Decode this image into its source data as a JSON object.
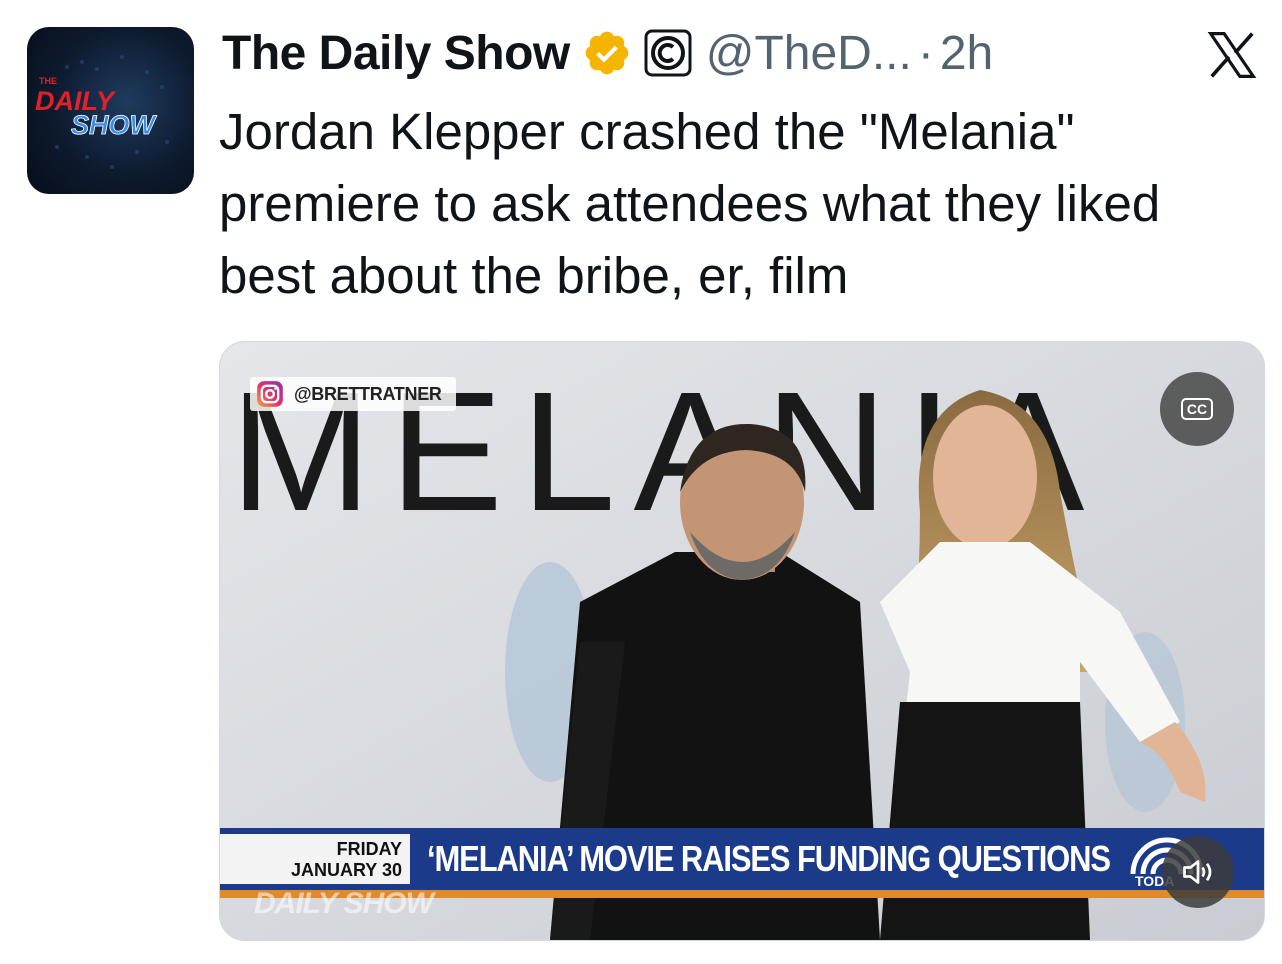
{
  "tweet": {
    "display_name": "The Daily Show",
    "handle": "@TheD...",
    "separator": "·",
    "time": "2h",
    "text": "Jordan Klepper crashed the \"Melania\" premiere to ask attendees what they liked best about the bribe, er, film",
    "verified_icon": "verified-badge-icon",
    "affiliation_icon": "comedy-central-icon"
  },
  "avatar": {
    "line1": "THE",
    "line2": "DAILY",
    "line3": "SHOW"
  },
  "media": {
    "backdrop_text": "MELANIA",
    "instagram_handle": "@BRETTRATNER",
    "caption_day": "FRIDAY",
    "caption_date": "JANUARY 30",
    "headline": "‘MELANIA’ MOVIE RAISES FUNDING QUESTIONS",
    "watermark": "DAILY SHOW",
    "cc_label": "CC",
    "today_label": "TODA"
  },
  "colors": {
    "text": "#0f1419",
    "secondary": "#536471",
    "verified_gold": "#f4b400",
    "lower_third_blue": "#1b3a8a",
    "orange_accent": "#e08a2a"
  }
}
